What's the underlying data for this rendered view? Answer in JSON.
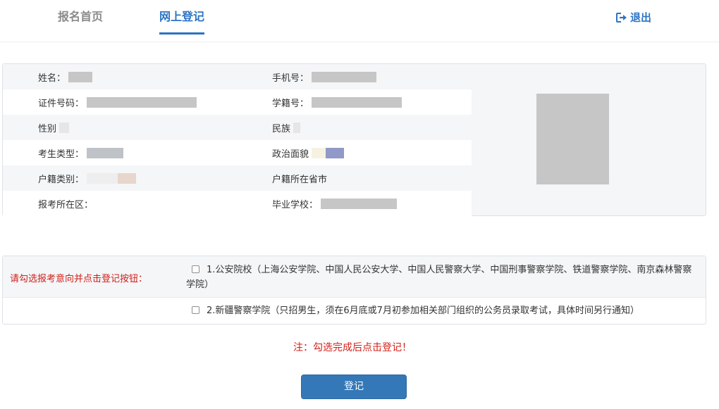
{
  "nav": {
    "tabs": [
      {
        "label": "报名首页"
      },
      {
        "label": "网上登记"
      }
    ],
    "logout_label": "退出",
    "accent": "#2c74c4"
  },
  "info": {
    "rows": [
      {
        "left_label": "姓名：",
        "right_label": "手机号："
      },
      {
        "left_label": "证件号码：",
        "right_label": "学籍号："
      },
      {
        "left_label": "性别",
        "right_label": "民族"
      },
      {
        "left_label": "考生类型：",
        "right_label": "政治面貌"
      },
      {
        "left_label": "户籍类别：",
        "right_label": "户籍所在省市"
      },
      {
        "left_label": "报考所在区：",
        "right_label": "毕业学校："
      }
    ]
  },
  "choice": {
    "prompt": "请勾选报考意向并点击登记按钮：",
    "options": [
      {
        "text": "1.公安院校（上海公安学院、中国人民公安大学、中国人民警察大学、中国刑事警察学院、铁道警察学院、南京森林警察学院）"
      },
      {
        "text": "2.新疆警察学院（只招男生，须在6月底或7月初参加相关部门组织的公务员录取考试，具体时间另行通知）"
      }
    ]
  },
  "note": "注：勾选完成后点击登记！",
  "submit_label": "登记",
  "colors": {
    "warning": "#d0201a",
    "button": "#3478b7"
  }
}
